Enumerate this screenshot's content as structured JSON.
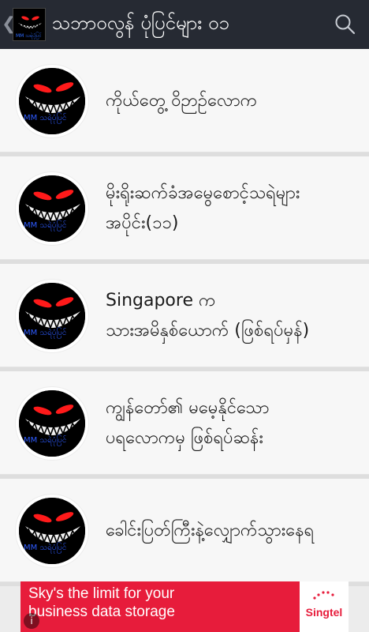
{
  "header": {
    "back_icon": "chevron-left-icon",
    "title": "သဘာဝလွန် ပုံပြင်များ ဝ၁",
    "search_icon": "search-icon",
    "logo_text": "MM သရဲပုံပြင်"
  },
  "list": {
    "avatar_text": "MM သရဲပုံပြင်",
    "items": [
      {
        "lines": [
          "ကိုယ်တွေ့ ဝိဉာဉ်လောက"
        ]
      },
      {
        "lines": [
          "မိုးရိုးဆက်ခံအမွေစောင့်သရဲများ",
          "အပိုင်း(၁၁)"
        ]
      },
      {
        "lines": [
          "Singapore က",
          "သားအမိနှစ်ယောက် (ဖြစ်ရပ်မှန်)"
        ]
      },
      {
        "lines": [
          "ကျွန်တော်၏ မမေ့နိုင်သော",
          "ပရလောကမှ ဖြစ်ရပ်ဆန်း"
        ]
      },
      {
        "lines": [
          "ခေါင်းပြတ်ကြီးနဲ့လျှောက်သွားနေရ"
        ]
      }
    ]
  },
  "ad": {
    "line1": "Sky's the limit for your",
    "line2": "business data storage",
    "brand": "Singtel",
    "info_icon": "info-icon",
    "brand_color": "#e71c3b"
  },
  "colors": {
    "header_bg": "#262a33",
    "list_bg": "#f7f7f7",
    "accent_red": "#e71c3b"
  }
}
